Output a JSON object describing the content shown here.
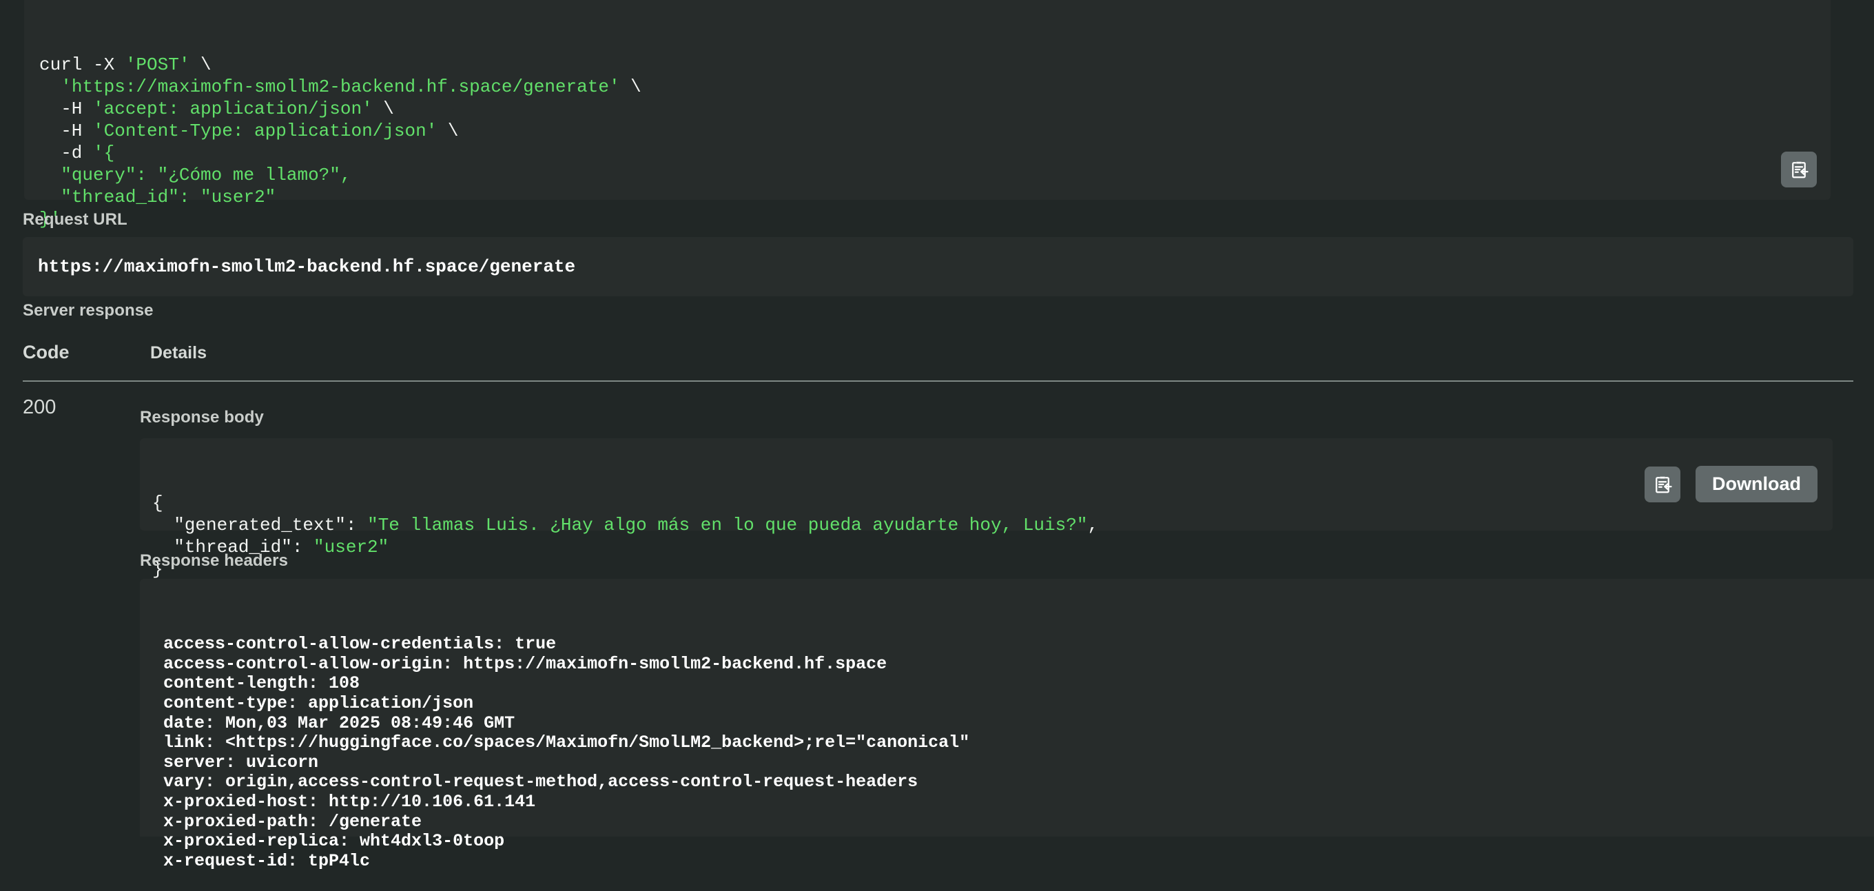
{
  "curl_request": {
    "icon": "copy-to-clipboard-icon",
    "lines": [
      [
        {
          "t": "curl -X ",
          "c": "wht"
        },
        {
          "t": "'POST'",
          "c": "grn"
        },
        {
          "t": " \\",
          "c": "wht"
        }
      ],
      [
        {
          "t": "  ",
          "c": "wht"
        },
        {
          "t": "'https://maximofn-smollm2-backend.hf.space/generate'",
          "c": "grn"
        },
        {
          "t": " \\",
          "c": "wht"
        }
      ],
      [
        {
          "t": "  -H ",
          "c": "wht"
        },
        {
          "t": "'accept: application/json'",
          "c": "grn"
        },
        {
          "t": " \\",
          "c": "wht"
        }
      ],
      [
        {
          "t": "  -H ",
          "c": "wht"
        },
        {
          "t": "'Content-Type: application/json'",
          "c": "grn"
        },
        {
          "t": " \\",
          "c": "wht"
        }
      ],
      [
        {
          "t": "  -d ",
          "c": "wht"
        },
        {
          "t": "'{",
          "c": "grn"
        }
      ],
      [
        {
          "t": "  ",
          "c": "wht"
        },
        {
          "t": "\"query\": \"¿Cómo me llamo?\",",
          "c": "grn"
        }
      ],
      [
        {
          "t": "  ",
          "c": "wht"
        },
        {
          "t": "\"thread_id\": \"user2\"",
          "c": "grn"
        }
      ],
      [
        {
          "t": "}'",
          "c": "grn"
        }
      ]
    ]
  },
  "request_url": {
    "label": "Request URL",
    "value": "https://maximofn-smollm2-backend.hf.space/generate"
  },
  "server_response": {
    "label": "Server response",
    "columns": {
      "code": "Code",
      "details": "Details"
    },
    "rows": [
      {
        "code": "200",
        "response_body": {
          "label": "Response body",
          "copy_icon": "copy-to-clipboard-icon",
          "download_label": "Download",
          "lines": [
            [
              {
                "t": "{",
                "c": "wht"
              }
            ],
            [
              {
                "t": "  \"generated_text\": ",
                "c": "wht"
              },
              {
                "t": "\"Te llamas Luis. ¿Hay algo más en lo que pueda ayudarte hoy, Luis?\"",
                "c": "grn"
              },
              {
                "t": ",",
                "c": "wht"
              }
            ],
            [
              {
                "t": "  \"thread_id\": ",
                "c": "wht"
              },
              {
                "t": "\"user2\"",
                "c": "grn"
              }
            ],
            [
              {
                "t": "}",
                "c": "wht"
              }
            ]
          ]
        },
        "response_headers": {
          "label": "Response headers",
          "lines": [
            "access-control-allow-credentials: true",
            "access-control-allow-origin: https://maximofn-smollm2-backend.hf.space",
            "content-length: 108",
            "content-type: application/json",
            "date: Mon,03 Mar 2025 08:49:46 GMT",
            "link: <https://huggingface.co/spaces/Maximofn/SmolLM2_backend>;rel=\"canonical\"",
            "server: uvicorn",
            "vary: origin,access-control-request-method,access-control-request-headers",
            "x-proxied-host: http://10.106.61.141",
            "x-proxied-path: /generate",
            "x-proxied-replica: wht4dxl3-0toop",
            "x-request-id: tpP4lc"
          ]
        }
      }
    ]
  },
  "colors": {
    "page_background": "#212726",
    "code_background": "#272c2b",
    "code_string_green": "#62e06a",
    "code_text_white": "#f2f4f2",
    "button_gray": "#61696a",
    "divider_gray": "#7e8884"
  }
}
